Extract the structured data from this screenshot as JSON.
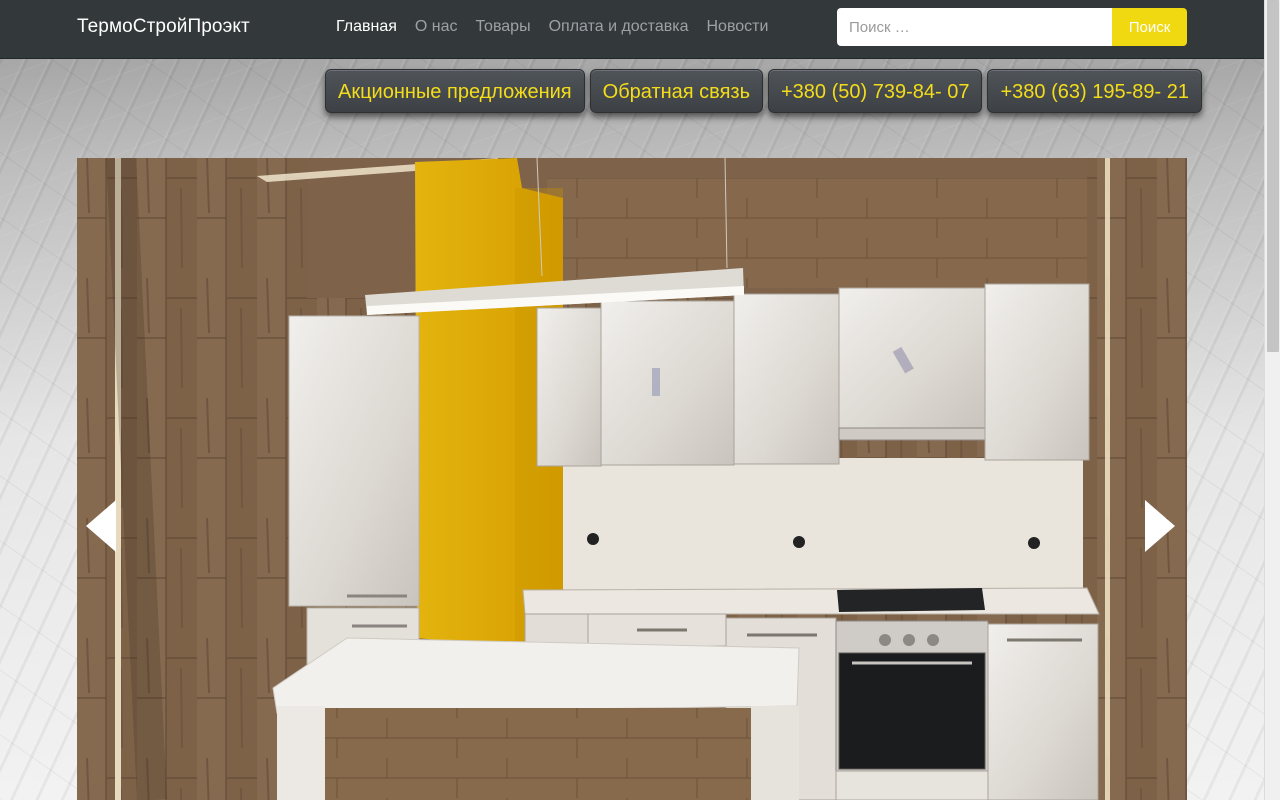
{
  "navbar": {
    "brand": "ТермоСтройПроэкт",
    "links": [
      {
        "label": "Главная",
        "active": true
      },
      {
        "label": "О нас",
        "active": false
      },
      {
        "label": "Товары",
        "active": false
      },
      {
        "label": "Оплата и доставка",
        "active": false
      },
      {
        "label": "Новости",
        "active": false
      }
    ],
    "search": {
      "placeholder": "Поиск …",
      "value": "",
      "button_label": "Поиск"
    }
  },
  "action_bar": {
    "promotions": "Акционные предложения",
    "feedback": "Обратная связь",
    "phone_1": "+380 (50) 739-84- 07",
    "phone_2": "+380 (63) 195-89- 21"
  },
  "slider": {
    "prev_icon": "chevron-left-icon",
    "next_icon": "chevron-right-icon"
  },
  "colors": {
    "navbar_bg": "#33383b",
    "accent_yellow": "#f0d910",
    "action_text": "#f3dc1a"
  }
}
